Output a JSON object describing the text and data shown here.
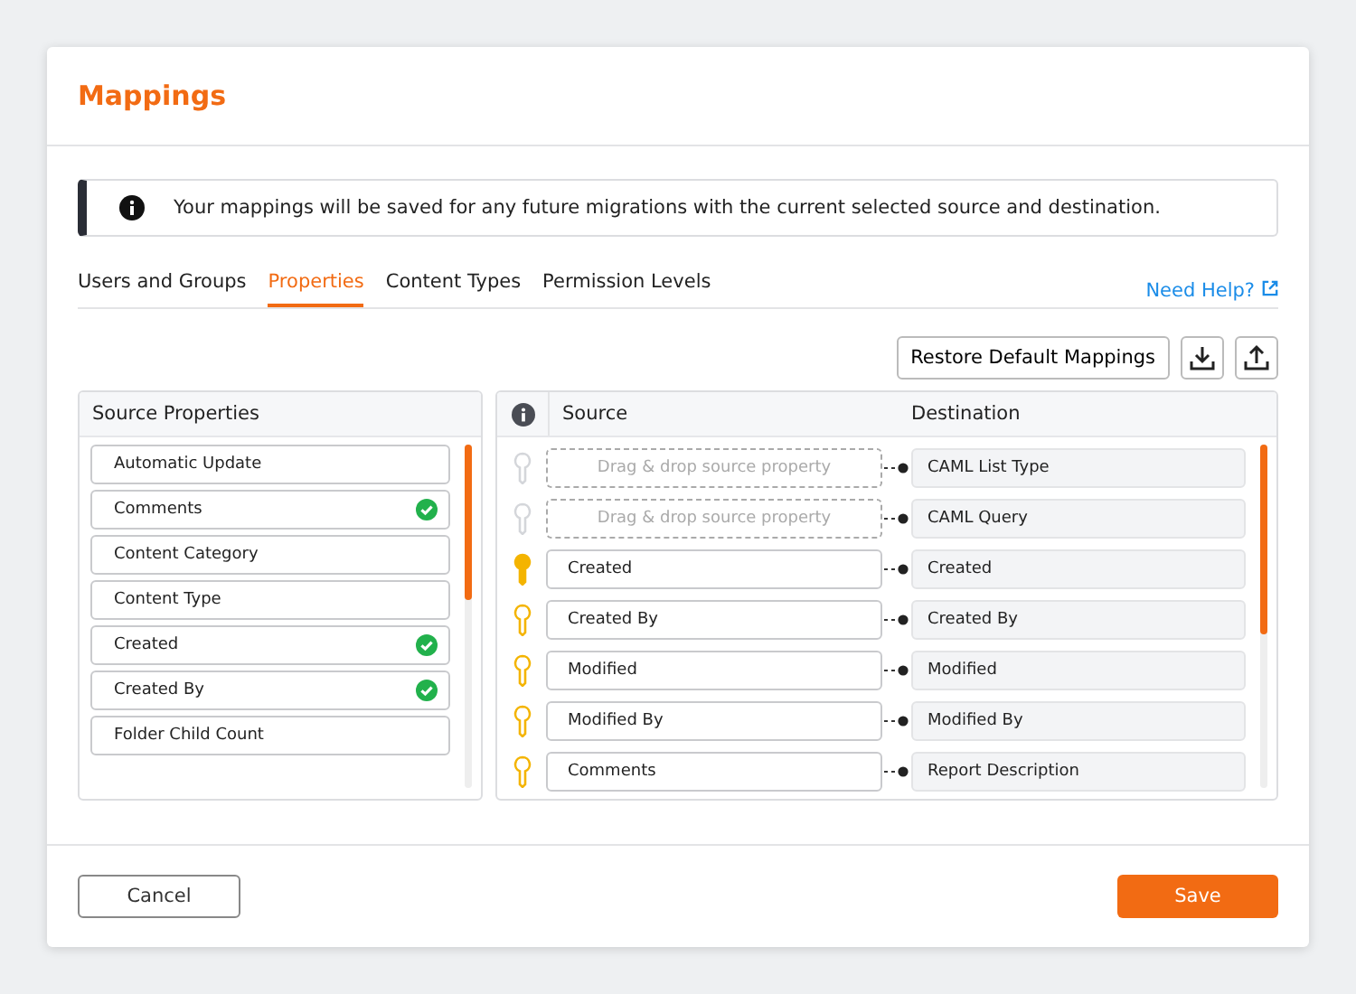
{
  "dialog": {
    "title": "Mappings"
  },
  "banner": {
    "text": "Your mappings will be saved for any future migrations with the current selected source and destination."
  },
  "tabs": [
    {
      "label": "Users and Groups",
      "selected": false
    },
    {
      "label": "Properties",
      "selected": true
    },
    {
      "label": "Content Types",
      "selected": false
    },
    {
      "label": "Permission Levels",
      "selected": false
    }
  ],
  "help_link": "Need Help?",
  "toolbar": {
    "restore_button": "Restore Default Mappings"
  },
  "source_properties": {
    "title": "Source Properties",
    "items": [
      {
        "label": "Automatic Update",
        "mapped": false
      },
      {
        "label": "Comments",
        "mapped": true
      },
      {
        "label": "Content Category",
        "mapped": false
      },
      {
        "label": "Content Type",
        "mapped": false
      },
      {
        "label": "Created",
        "mapped": true
      },
      {
        "label": "Created By",
        "mapped": true
      },
      {
        "label": "Folder Child Count",
        "mapped": false
      }
    ]
  },
  "mapping_table": {
    "columns": [
      "Source",
      "Destination"
    ],
    "rows": [
      {
        "kind": "placeholder",
        "primary": false,
        "source": "Drag & drop source property",
        "destination": "CAML List Type"
      },
      {
        "kind": "placeholder",
        "primary": false,
        "source": "Drag & drop source property",
        "destination": "CAML Query"
      },
      {
        "kind": "mapped",
        "primary": true,
        "source": "Created",
        "destination": "Created"
      },
      {
        "kind": "mapped",
        "primary": false,
        "source": "Created By",
        "destination": "Created By"
      },
      {
        "kind": "mapped",
        "primary": false,
        "source": "Modified",
        "destination": "Modified"
      },
      {
        "kind": "mapped",
        "primary": false,
        "source": "Modified By",
        "destination": "Modified By"
      },
      {
        "kind": "mapped",
        "primary": false,
        "source": "Comments",
        "destination": "Report Description"
      }
    ]
  },
  "footer": {
    "cancel_button": "Cancel",
    "save_button": "Save"
  }
}
